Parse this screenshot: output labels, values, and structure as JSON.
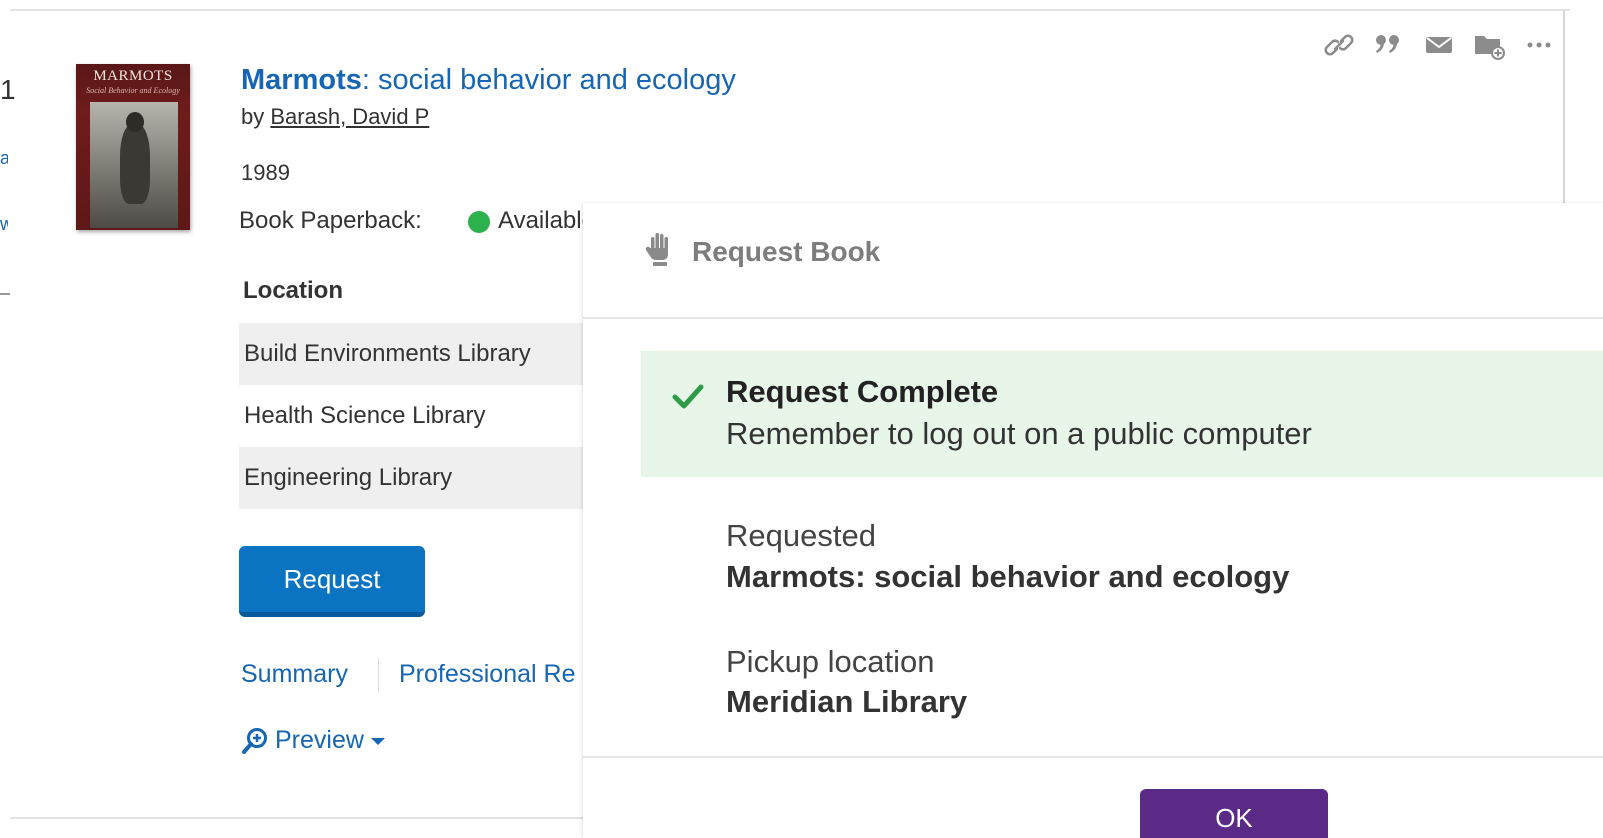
{
  "result": {
    "number": "1",
    "left_fragments": [
      "a",
      "w"
    ],
    "cover": {
      "title": "MARMOTS",
      "subtitle": "Social Behavior and Ecology"
    },
    "title_bold": "Marmots",
    "title_rest": ": social behavior and ecology",
    "by": "by",
    "author": "Barash, David P",
    "year": "1989",
    "format_label": "Book Paperback:",
    "availability": "Available",
    "availability_color": "#2bb24c",
    "location_header": "Location",
    "locations": [
      "Build Environments Library",
      "Health Science Library",
      "Engineering Library"
    ],
    "request_button": "Request",
    "tabs": [
      "Summary",
      "Professional Re"
    ],
    "preview": "Preview",
    "action_icons": [
      "link-icon",
      "quote-icon",
      "email-icon",
      "add-to-folder-icon",
      "more-icon"
    ]
  },
  "modal": {
    "title": "Request Book",
    "head_icon": "hand-icon",
    "success_title": "Request Complete",
    "success_message": "Remember to log out on a public computer",
    "requested_label": "Requested",
    "requested_value": "Marmots: social behavior and ecology",
    "pickup_label": "Pickup location",
    "pickup_value": "Meridian Library",
    "ok_button": "OK"
  },
  "colors": {
    "link": "#1766b3",
    "primary_button": "#0a73c2",
    "ok_button": "#5a2a86",
    "success_bg": "#e8f5e9",
    "check": "#2e9b47"
  }
}
